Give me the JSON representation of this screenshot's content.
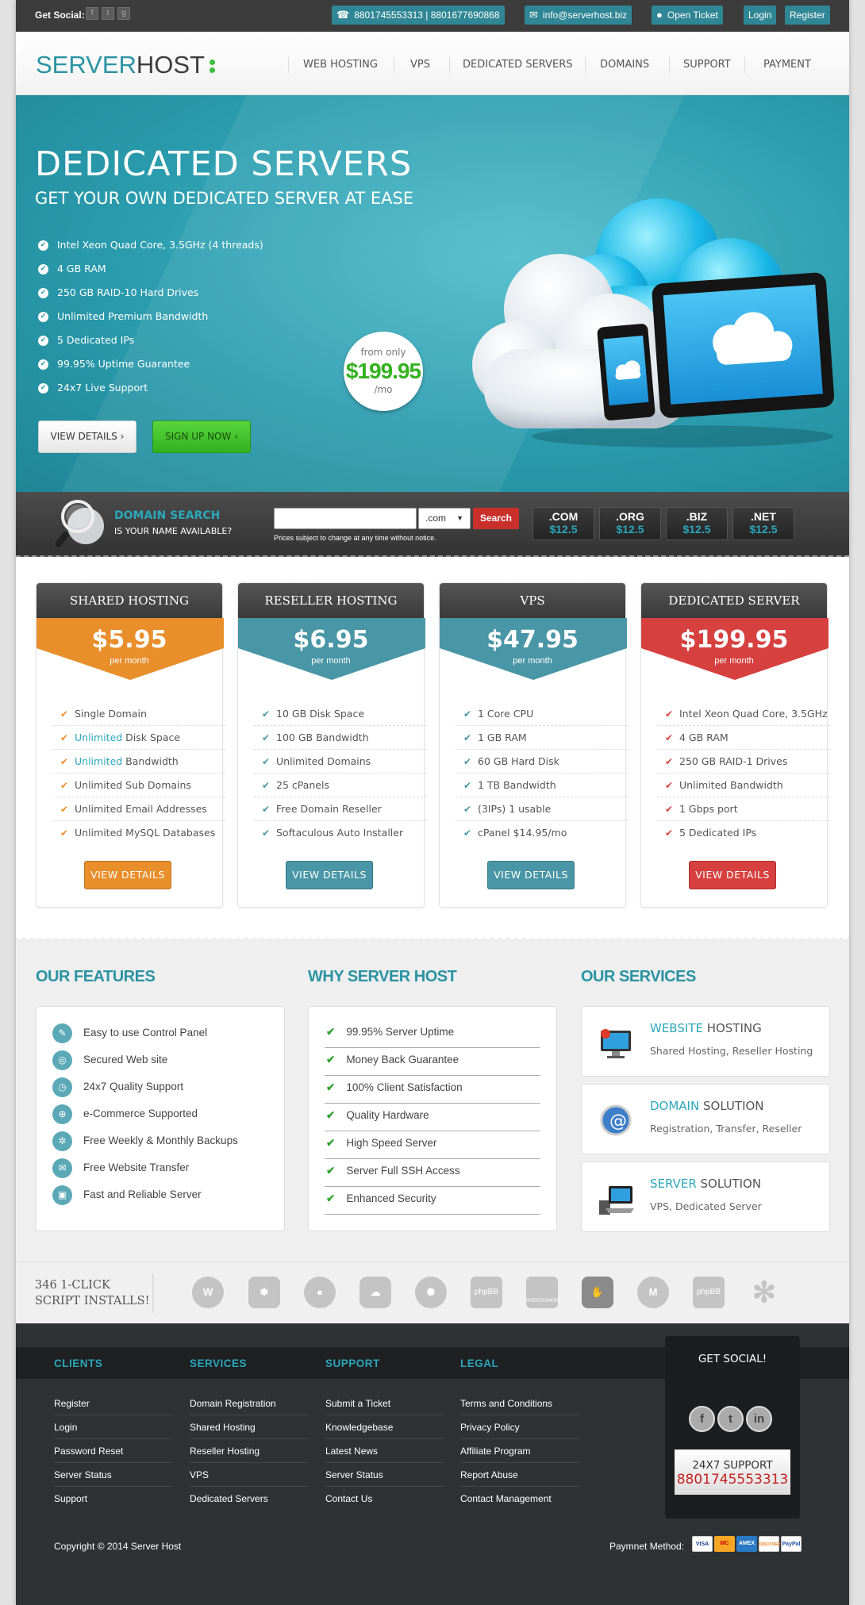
{
  "topbar": {
    "social_label": "Get Social:",
    "social_icons": [
      "facebook-icon",
      "twitter-icon",
      "google-plus-icon"
    ],
    "phone": "8801745553313 | 8801677690868",
    "email": "info@serverhost.biz",
    "open_ticket": "Open Ticket",
    "login": "Login",
    "register": "Register"
  },
  "header": {
    "logo_part1": "SERVER",
    "logo_part2": "HOST",
    "nav": [
      "WEB HOSTING",
      "VPS",
      "DEDICATED SERVERS",
      "DOMAINS",
      "SUPPORT",
      "PAYMENT"
    ]
  },
  "hero": {
    "title": "DEDICATED SERVERS",
    "subtitle": "GET YOUR OWN DEDICATED SERVER AT EASE",
    "features": [
      "Intel Xeon Quad Core, 3.5GHz (4 threads)",
      "4 GB RAM",
      "250 GB RAID-10 Hard Drives",
      "Unlimited Premium Bandwidth",
      "5 Dedicated IPs",
      "99.95% Uptime Guarantee",
      "24x7 Live Support"
    ],
    "view_details": "VIEW DETAILS",
    "sign_up": "SIGN UP NOW",
    "from_only": "from only",
    "price": "$199.95",
    "per": "/mo"
  },
  "domain": {
    "title": "DOMAIN SEARCH",
    "subtitle": "IS YOUR NAME AVAILABLE?",
    "tld_selected": ".com",
    "search_button": "Search",
    "note": "Prices subject to change at any time without notice.",
    "tlds": [
      {
        "name": ".COM",
        "price": "$12.5"
      },
      {
        "name": ".ORG",
        "price": "$12.5"
      },
      {
        "name": ".BIZ",
        "price": "$12.5"
      },
      {
        "name": ".NET",
        "price": "$12.5"
      }
    ]
  },
  "plans": [
    {
      "name": "SHARED HOSTING",
      "price": "$5.95",
      "per": "per month",
      "color": "#e88f2c",
      "button": "VIEW DETAILS",
      "items": [
        [
          "",
          "Single Domain"
        ],
        [
          "Unlimited",
          " Disk Space"
        ],
        [
          "Unlimited",
          " Bandwidth"
        ],
        [
          "",
          "Unlimited Sub Domains"
        ],
        [
          "",
          "Unlimited Email Addresses"
        ],
        [
          "",
          "Unlimited MySQL Databases"
        ]
      ]
    },
    {
      "name": "RESELLER HOSTING",
      "price": "$6.95",
      "per": "per month",
      "color": "#4996a6",
      "button": "VIEW DETAILS",
      "items": [
        [
          "",
          "10 GB Disk Space"
        ],
        [
          "",
          "100 GB Bandwidth"
        ],
        [
          "",
          "Unlimited Domains"
        ],
        [
          "",
          "25 cPanels"
        ],
        [
          "",
          "Free Domain Reseller"
        ],
        [
          "",
          "Softaculous Auto Installer"
        ]
      ]
    },
    {
      "name": "VPS",
      "price": "$47.95",
      "per": "per month",
      "color": "#4996a6",
      "button": "VIEW DETAILS",
      "items": [
        [
          "",
          "1 Core CPU"
        ],
        [
          "",
          "1 GB RAM"
        ],
        [
          "",
          "60 GB Hard Disk"
        ],
        [
          "",
          "1 TB Bandwidth"
        ],
        [
          "",
          "(3IPs) 1 usable"
        ],
        [
          "",
          "cPanel $14.95/mo"
        ]
      ]
    },
    {
      "name": "DEDICATED SERVER",
      "price": "$199.95",
      "per": "per month",
      "color": "#d6403f",
      "button": "VIEW DETAILS",
      "items": [
        [
          "",
          "Intel Xeon Quad Core, 3.5GHz"
        ],
        [
          "",
          "4 GB RAM"
        ],
        [
          "",
          "250 GB RAID-1 Drives"
        ],
        [
          "",
          "Unlimited Bandwidth"
        ],
        [
          "",
          "1 Gbps port"
        ],
        [
          "",
          "5 Dedicated IPs"
        ]
      ]
    }
  ],
  "features": {
    "title": "OUR FEATURES",
    "items": [
      {
        "icon": "wrench-icon",
        "glyph": "✎",
        "label": "Easy to use Control Panel"
      },
      {
        "icon": "globe-icon",
        "glyph": "◎",
        "label": "Secured Web site"
      },
      {
        "icon": "clock-icon",
        "glyph": "◷",
        "label": "24x7 Quality Support"
      },
      {
        "icon": "cart-icon",
        "glyph": "⊕",
        "label": "e-Commerce Supported"
      },
      {
        "icon": "gear-icon",
        "glyph": "✲",
        "label": "Free Weekly & Monthly Backups"
      },
      {
        "icon": "mail-icon",
        "glyph": "✉",
        "label": "Free Website Transfer"
      },
      {
        "icon": "image-icon",
        "glyph": "▣",
        "label": "Fast and Reliable Server"
      }
    ]
  },
  "why": {
    "title": "WHY SERVER HOST",
    "items": [
      "99.95% Server Uptime",
      "Money Back Guarantee",
      "100% Client Satisfaction",
      "Quality Hardware",
      "High Speed Server",
      "Server Full SSH Access",
      "Enhanced Security"
    ]
  },
  "services": {
    "title": "OUR SERVICES",
    "items": [
      {
        "accent": "WEBSITE",
        "rest": " HOSTING",
        "desc": "Shared Hosting, Reseller Hosting",
        "icon": "monitor-icon"
      },
      {
        "accent": "DOMAIN",
        "rest": " SOLUTION",
        "desc": "Registration, Transfer, Reseller",
        "icon": "at-globe-icon"
      },
      {
        "accent": "SERVER",
        "rest": " SOLUTION",
        "desc": "VPS, Dedicated Server",
        "icon": "server-laptop-icon"
      }
    ]
  },
  "scripts": {
    "label_line1": "346 1-CLICK",
    "label_line2": "SCRIPT INSTALLS!",
    "logos": [
      "wordpress-icon",
      "joomla-icon",
      "drupal-icon",
      "cloud-script-icon",
      "swirl-icon",
      "phpbb-icon",
      "prestashop-icon",
      "hand-icon",
      "magento-icon",
      "phpbb2-icon",
      "asterisk-icon"
    ],
    "logo_texts": [
      "phpBB",
      "PRESTASHOP",
      "phpBB"
    ]
  },
  "footer": {
    "columns": [
      {
        "title": "CLIENTS",
        "links": [
          "Register",
          "Login",
          "Password Reset",
          "Server Status",
          "Support"
        ]
      },
      {
        "title": "SERVICES",
        "links": [
          "Domain Registration",
          "Shared Hosting",
          "Reseller Hosting",
          "VPS",
          "Dedicated Servers"
        ]
      },
      {
        "title": "SUPPORT",
        "links": [
          "Submit a Ticket",
          "Knowledgebase",
          "Latest News",
          "Server Status",
          "Contact Us"
        ]
      },
      {
        "title": "LEGAL",
        "links": [
          "Terms and Conditions",
          "Privacy Policy",
          "Affiliate Program",
          "Report Abuse",
          "Contact Management"
        ]
      }
    ],
    "get_social": "GET SOCIAL!",
    "support_label": "24X7 SUPPORT",
    "support_phone": "8801745553313",
    "copyright": "Copyright © 2014   Server Host",
    "payment_label": "Paymnet Method:",
    "payment_cards": [
      "VISA",
      "MC",
      "AMEX",
      "DISCOVER",
      "PayPal"
    ]
  }
}
